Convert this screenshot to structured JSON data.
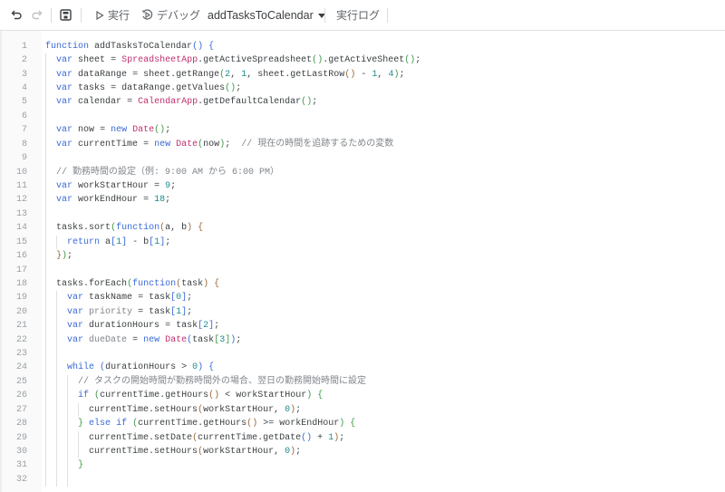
{
  "toolbar": {
    "undo_icon": "undo-icon",
    "redo_icon": "redo-icon",
    "save_icon": "save-icon",
    "run_label": "実行",
    "debug_label": "デバッグ",
    "function_select": "addTasksToCalendar",
    "log_label": "実行ログ"
  },
  "colors": {
    "keyword": "#3b6ad6",
    "class": "#c2306f",
    "number": "#1e8c8c",
    "comment": "#80868b"
  },
  "code": {
    "start_line": 1,
    "lines": [
      "function addTasksToCalendar() {",
      "  var sheet = SpreadsheetApp.getActiveSpreadsheet().getActiveSheet();",
      "  var dataRange = sheet.getRange(2, 1, sheet.getLastRow() - 1, 4);",
      "  var tasks = dataRange.getValues();",
      "  var calendar = CalendarApp.getDefaultCalendar();",
      "",
      "  var now = new Date();",
      "  var currentTime = new Date(now);  // 現在の時間を追跡するための変数",
      "",
      "  // 勤務時間の設定（例: 9:00 AM から 6:00 PM）",
      "  var workStartHour = 9;",
      "  var workEndHour = 18;",
      "",
      "  tasks.sort(function(a, b) {",
      "    return a[1] - b[1];",
      "  });",
      "",
      "  tasks.forEach(function(task) {",
      "    var taskName = task[0];",
      "    var priority = task[1];",
      "    var durationHours = task[2];",
      "    var dueDate = new Date(task[3]);",
      "",
      "    while (durationHours > 0) {",
      "      // タスクの開始時間が勤務時間外の場合、翌日の勤務開始時間に設定",
      "      if (currentTime.getHours() < workStartHour) {",
      "        currentTime.setHours(workStartHour, 0);",
      "      } else if (currentTime.getHours() >= workEndHour) {",
      "        currentTime.setDate(currentTime.getDate() + 1);",
      "        currentTime.setHours(workStartHour, 0);",
      "      }",
      ""
    ]
  }
}
